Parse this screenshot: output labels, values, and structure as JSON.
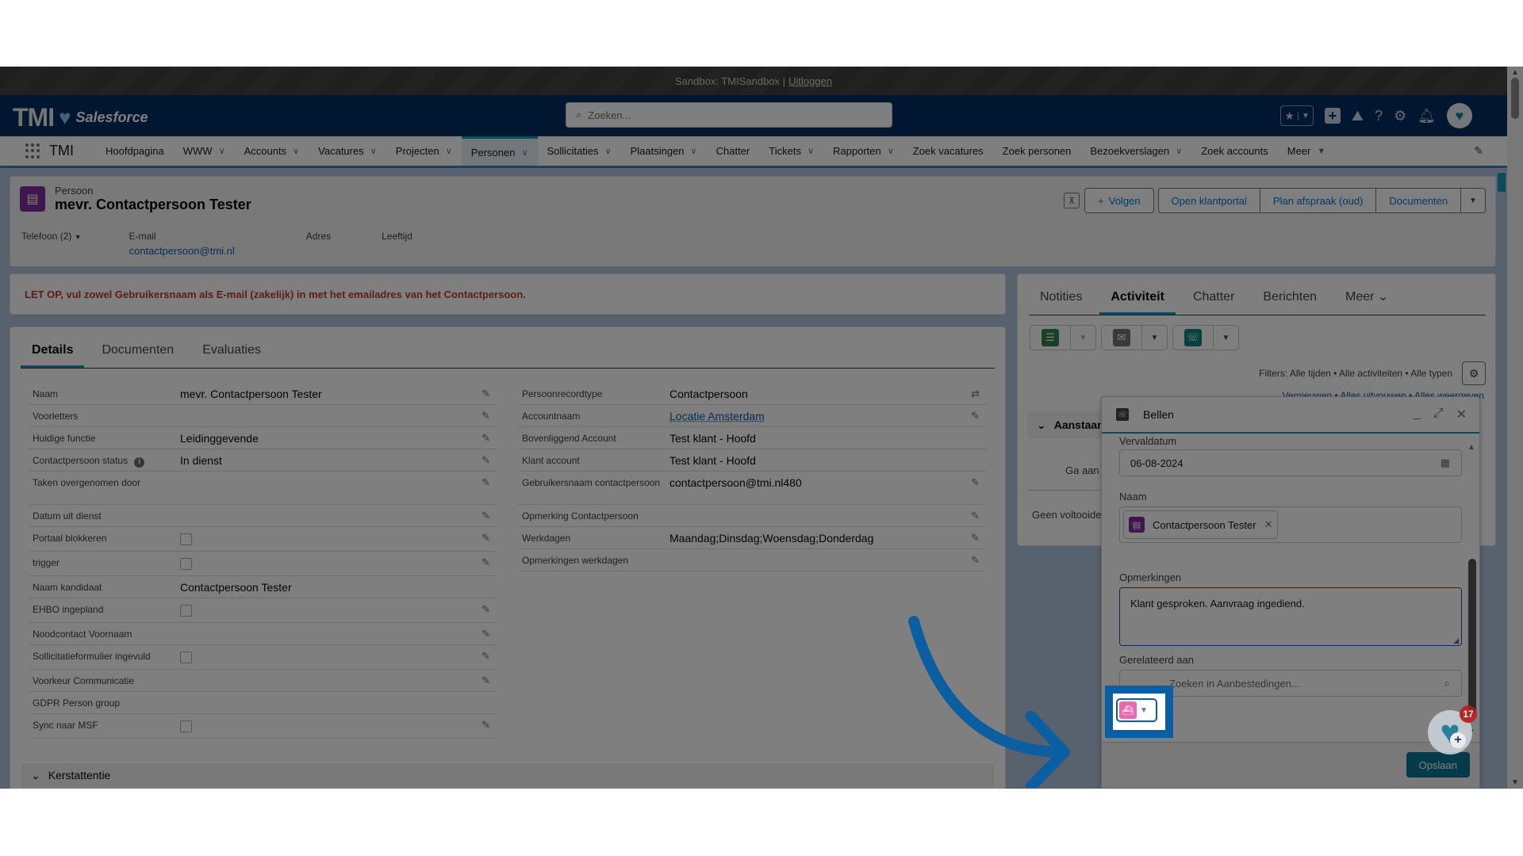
{
  "sandbox_bar": {
    "text": "Sandbox: TMISandbox |",
    "logout": "Uitloggen"
  },
  "header": {
    "logo_text": "TMI",
    "logo_brand": "Salesforce",
    "search_placeholder": "Zoeken..."
  },
  "nav": {
    "app_name": "TMI",
    "items": [
      {
        "label": "Hoofdpagina",
        "dropdown": false
      },
      {
        "label": "WWW",
        "dropdown": true
      },
      {
        "label": "Accounts",
        "dropdown": true
      },
      {
        "label": "Vacatures",
        "dropdown": true
      },
      {
        "label": "Projecten",
        "dropdown": true
      },
      {
        "label": "Personen",
        "dropdown": true,
        "active": true
      },
      {
        "label": "Sollicitaties",
        "dropdown": true
      },
      {
        "label": "Plaatsingen",
        "dropdown": true
      },
      {
        "label": "Chatter",
        "dropdown": false
      },
      {
        "label": "Tickets",
        "dropdown": true
      },
      {
        "label": "Rapporten",
        "dropdown": true
      },
      {
        "label": "Zoek vacatures",
        "dropdown": false
      },
      {
        "label": "Zoek personen",
        "dropdown": false
      },
      {
        "label": "Bezoekverslagen",
        "dropdown": true
      },
      {
        "label": "Zoek accounts",
        "dropdown": false
      },
      {
        "label": "Meer",
        "dropdown": true
      }
    ]
  },
  "record": {
    "type": "Persoon",
    "title": "mevr. Contactpersoon Tester",
    "actions": {
      "follow": "Volgen",
      "portal": "Open klantportal",
      "plan": "Plan afspraak (oud)",
      "docs": "Documenten"
    },
    "highlights": {
      "phone_label": "Telefoon (2)",
      "email_label": "E-mail",
      "email_value": "contactpersoon@tmi.nl",
      "address_label": "Adres",
      "age_label": "Leeftijd"
    }
  },
  "warning": "LET OP, vul zowel Gebruikersnaam als E-mail (zakelijk) in met het emailadres van het Contactpersoon.",
  "details": {
    "tabs": [
      "Details",
      "Documenten",
      "Evaluaties"
    ],
    "left_fields": [
      {
        "label": "Naam",
        "value": "mevr. Contactpersoon Tester",
        "editable": true
      },
      {
        "label": "Voorletters",
        "value": "",
        "editable": true
      },
      {
        "label": "Huidige functie",
        "value": "Leidinggevende",
        "editable": true
      },
      {
        "label": "Contactpersoon status",
        "value": "In dienst",
        "editable": true,
        "info": true
      },
      {
        "label": "Taken overgenomen door",
        "value": "",
        "editable": true,
        "tall": true
      },
      {
        "label": "Datum uit dienst",
        "value": "",
        "editable": true
      },
      {
        "label": "Portaal blokkeren",
        "checkbox": true,
        "checked": false,
        "editable": true
      },
      {
        "label": "trigger",
        "checkbox": true,
        "checked": false,
        "editable": true
      },
      {
        "label": "Naam kandidaat",
        "value": "Contactpersoon Tester",
        "editable": false
      },
      {
        "label": "EHBO ingepland",
        "checkbox": true,
        "checked": false,
        "editable": true
      },
      {
        "label": "Noodcontact Voornaam",
        "value": "",
        "editable": true
      },
      {
        "label": "Sollicitatieformulier ingevuld",
        "checkbox": true,
        "checked": false,
        "editable": true
      },
      {
        "label": "Voorkeur Communicatie",
        "value": "",
        "editable": true
      },
      {
        "label": "GDPR Person group",
        "value": "",
        "editable": false
      },
      {
        "label": "Sync naar MSF",
        "checkbox": true,
        "checked": false,
        "editable": true
      }
    ],
    "right_fields": [
      {
        "label": "Persoonrecordtype",
        "value": "Contactpersoon",
        "editable": false,
        "change_icon": true
      },
      {
        "label": "Accountnaam",
        "value": "Locatie Amsterdam",
        "editable": true,
        "link": true
      },
      {
        "label": "Bovenliggend Account",
        "value": "Test klant - Hoofd",
        "editable": false
      },
      {
        "label": "Klant account",
        "value": "Test klant - Hoofd",
        "editable": false
      },
      {
        "label": "Gebruikersnaam contactpersoon",
        "value": "contactpersoon@tmi.nl480",
        "editable": true,
        "tall": true
      },
      {
        "label": "Opmerking Contactpersoon",
        "value": "",
        "editable": true
      },
      {
        "label": "Werkdagen",
        "value": "Maandag;Dinsdag;Woensdag;Donderdag",
        "editable": true
      },
      {
        "label": "Opmerkingen werkdagen",
        "value": "",
        "editable": true
      }
    ],
    "section": "Kerstattentie"
  },
  "activity": {
    "tabs": [
      "Notities",
      "Activiteit",
      "Chatter",
      "Berichten",
      "Meer"
    ],
    "active_tab": "Activiteit",
    "filters": "Filters: Alle tijden • Alle activiteiten • Alle typen",
    "links": "Vernieuwen  •  Alles uitvouwen  •  Alles weergeven",
    "upcoming": "Aanstaand",
    "go_text": "Ga aan",
    "none_text": "Geen voltooide"
  },
  "modal": {
    "title": "Bellen",
    "due_label": "Vervaldatum",
    "due_value": "06-08-2024",
    "name_label": "Naam",
    "name_value": "Contactpersoon Tester",
    "notes_label": "Opmerkingen",
    "notes_value": "Klant gesproken. Aanvraag ingediend.",
    "related_label": "Gerelateerd aan",
    "related_placeholder": "Zoeken in Aanbestedingen...",
    "save": "Opslaan"
  },
  "fab": {
    "badge": "17"
  },
  "colors": {
    "accent": "#1b96b8",
    "brand_navy": "#032d60",
    "highlight": "#0b5ea0",
    "warning": "#c23934",
    "record_icon": "#7f2c9e"
  }
}
